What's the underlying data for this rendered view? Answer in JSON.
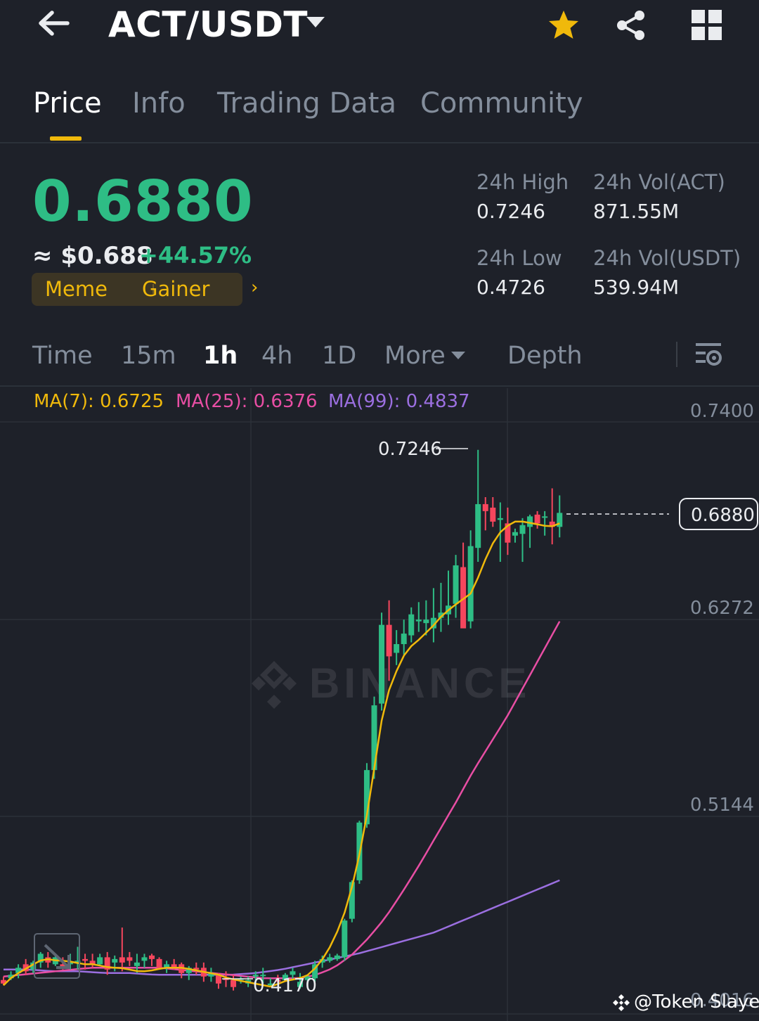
{
  "header": {
    "pair": "ACT/USDT",
    "icons": [
      "back-arrow-icon",
      "chevron-down-icon",
      "star-icon",
      "share-icon",
      "grid-icon"
    ],
    "star_color": "#f0b90b"
  },
  "tabs": [
    {
      "label": "Price",
      "active": true
    },
    {
      "label": "Info",
      "active": false
    },
    {
      "label": "Trading Data",
      "active": false
    },
    {
      "label": "Community",
      "active": false
    }
  ],
  "ticker": {
    "price": "0.6880",
    "fiat_price": "≈ $0.688",
    "change": "+44.57%",
    "tags": [
      "Meme",
      "Gainer"
    ],
    "stats": {
      "high_label": "24h High",
      "high": "0.7246",
      "low_label": "24h Low",
      "low": "0.4726",
      "vol_base_label": "24h Vol(ACT)",
      "vol_base": "871.55M",
      "vol_quote_label": "24h Vol(USDT)",
      "vol_quote": "539.94M"
    }
  },
  "intervals": {
    "items": [
      {
        "label": "Time",
        "active": false
      },
      {
        "label": "15m",
        "active": false
      },
      {
        "label": "1h",
        "active": true
      },
      {
        "label": "4h",
        "active": false
      },
      {
        "label": "1D",
        "active": false
      },
      {
        "label": "More",
        "active": false
      },
      {
        "label": "Depth",
        "active": false
      }
    ]
  },
  "chart_data": {
    "type": "candlestick",
    "watermark": "BINANCE",
    "ma_legend": [
      {
        "label": "MA(7): 0.6725",
        "color": "#f0b90b"
      },
      {
        "label": "MA(25): 0.6376",
        "color": "#e84ea4"
      },
      {
        "label": "MA(99): 0.4837",
        "color": "#9b6fe0"
      }
    ],
    "y_axis_labels": [
      "0.7400",
      "0.6272",
      "0.5144",
      "0.4016"
    ],
    "ylim": [
      0.4016,
      0.74
    ],
    "last_price_label": "0.6880",
    "high_annotation": "0.7246",
    "low_annotation": "0.4170",
    "colors": {
      "up": "#2ebd85",
      "down": "#f6465d",
      "ma7": "#f0b90b",
      "ma25": "#e84ea4",
      "ma99": "#9b6fe0"
    },
    "candles": [
      [
        0.421,
        0.423,
        0.418,
        0.419
      ],
      [
        0.422,
        0.426,
        0.421,
        0.424
      ],
      [
        0.425,
        0.43,
        0.422,
        0.428
      ],
      [
        0.43,
        0.433,
        0.424,
        0.426
      ],
      [
        0.427,
        0.432,
        0.425,
        0.431
      ],
      [
        0.431,
        0.437,
        0.428,
        0.436
      ],
      [
        0.434,
        0.437,
        0.428,
        0.431
      ],
      [
        0.43,
        0.436,
        0.429,
        0.434
      ],
      [
        0.43,
        0.434,
        0.427,
        0.428
      ],
      [
        0.43,
        0.436,
        0.427,
        0.431
      ],
      [
        0.431,
        0.44,
        0.427,
        0.432
      ],
      [
        0.433,
        0.436,
        0.427,
        0.432
      ],
      [
        0.432,
        0.436,
        0.428,
        0.43
      ],
      [
        0.43,
        0.436,
        0.429,
        0.434
      ],
      [
        0.434,
        0.437,
        0.424,
        0.427
      ],
      [
        0.431,
        0.435,
        0.426,
        0.433
      ],
      [
        0.434,
        0.451,
        0.426,
        0.431
      ],
      [
        0.434,
        0.437,
        0.429,
        0.432
      ],
      [
        0.429,
        0.436,
        0.425,
        0.431
      ],
      [
        0.432,
        0.436,
        0.428,
        0.434
      ],
      [
        0.435,
        0.436,
        0.429,
        0.433
      ],
      [
        0.433,
        0.434,
        0.427,
        0.428
      ],
      [
        0.428,
        0.432,
        0.425,
        0.43
      ],
      [
        0.43,
        0.433,
        0.427,
        0.428
      ],
      [
        0.43,
        0.431,
        0.422,
        0.425
      ],
      [
        0.425,
        0.429,
        0.421,
        0.428
      ],
      [
        0.428,
        0.431,
        0.424,
        0.427
      ],
      [
        0.428,
        0.431,
        0.42,
        0.423
      ],
      [
        0.423,
        0.428,
        0.42,
        0.425
      ],
      [
        0.424,
        0.425,
        0.416,
        0.419
      ],
      [
        0.422,
        0.426,
        0.417,
        0.421
      ],
      [
        0.421,
        0.424,
        0.415,
        0.417
      ],
      [
        0.421,
        0.423,
        0.419,
        0.422
      ],
      [
        0.419,
        0.423,
        0.417,
        0.421
      ],
      [
        0.423,
        0.426,
        0.419,
        0.424
      ],
      [
        0.424,
        0.428,
        0.419,
        0.424
      ],
      [
        0.418,
        0.422,
        0.417,
        0.419
      ],
      [
        0.421,
        0.424,
        0.419,
        0.42
      ],
      [
        0.421,
        0.425,
        0.42,
        0.424
      ],
      [
        0.424,
        0.428,
        0.421,
        0.426
      ],
      [
        0.417,
        0.425,
        0.416,
        0.42
      ],
      [
        0.421,
        0.424,
        0.419,
        0.423
      ],
      [
        0.422,
        0.432,
        0.42,
        0.43
      ],
      [
        0.431,
        0.435,
        0.428,
        0.433
      ],
      [
        0.432,
        0.436,
        0.431,
        0.434
      ],
      [
        0.433,
        0.436,
        0.432,
        0.435
      ],
      [
        0.434,
        0.456,
        0.432,
        0.455
      ],
      [
        0.456,
        0.478,
        0.454,
        0.477
      ],
      [
        0.478,
        0.512,
        0.476,
        0.511
      ],
      [
        0.51,
        0.545,
        0.508,
        0.541
      ],
      [
        0.541,
        0.583,
        0.536,
        0.578
      ],
      [
        0.579,
        0.631,
        0.575,
        0.624
      ],
      [
        0.624,
        0.638,
        0.592,
        0.606
      ],
      [
        0.608,
        0.621,
        0.601,
        0.613
      ],
      [
        0.613,
        0.627,
        0.607,
        0.619
      ],
      [
        0.618,
        0.634,
        0.614,
        0.63
      ],
      [
        0.626,
        0.637,
        0.62,
        0.627
      ],
      [
        0.625,
        0.638,
        0.618,
        0.627
      ],
      [
        0.622,
        0.645,
        0.614,
        0.628
      ],
      [
        0.628,
        0.648,
        0.62,
        0.631
      ],
      [
        0.63,
        0.655,
        0.624,
        0.635
      ],
      [
        0.636,
        0.664,
        0.628,
        0.658
      ],
      [
        0.657,
        0.671,
        0.624,
        0.622
      ],
      [
        0.626,
        0.678,
        0.622,
        0.669
      ],
      [
        0.668,
        0.724,
        0.66,
        0.693
      ],
      [
        0.693,
        0.697,
        0.678,
        0.689
      ],
      [
        0.691,
        0.697,
        0.68,
        0.683
      ],
      [
        0.684,
        0.694,
        0.66,
        0.685
      ],
      [
        0.682,
        0.691,
        0.664,
        0.671
      ],
      [
        0.675,
        0.679,
        0.671,
        0.677
      ],
      [
        0.676,
        0.685,
        0.66,
        0.681
      ],
      [
        0.68,
        0.687,
        0.668,
        0.686
      ],
      [
        0.687,
        0.689,
        0.679,
        0.682
      ],
      [
        0.686,
        0.689,
        0.675,
        0.686
      ],
      [
        0.683,
        0.702,
        0.67,
        0.68
      ],
      [
        0.68,
        0.698,
        0.674,
        0.688
      ]
    ],
    "ma7": [
      0.418,
      0.423,
      0.426,
      0.429,
      0.432,
      0.433,
      0.432,
      0.432,
      0.431,
      0.43,
      0.43,
      0.429,
      0.428,
      0.428,
      0.427,
      0.426,
      0.426,
      0.427,
      0.428,
      0.428,
      0.428,
      0.427,
      0.426,
      0.425,
      0.424,
      0.422,
      0.421,
      0.42,
      0.419,
      0.418,
      0.417,
      0.42,
      0.421,
      0.422,
      0.424,
      0.429,
      0.436,
      0.446,
      0.459,
      0.477,
      0.5,
      0.53,
      0.566,
      0.587,
      0.6,
      0.61,
      0.614,
      0.619,
      0.624,
      0.63,
      0.634,
      0.638,
      0.641,
      0.652,
      0.665,
      0.675,
      0.68,
      0.683,
      0.683,
      0.682,
      0.681,
      0.68,
      0.682
    ],
    "ma25": [
      0.423,
      0.424,
      0.425,
      0.426,
      0.427,
      0.428,
      0.428,
      0.428,
      0.428,
      0.428,
      0.427,
      0.426,
      0.425,
      0.424,
      0.423,
      0.422,
      0.422,
      0.422,
      0.424,
      0.428,
      0.435,
      0.445,
      0.457,
      0.472,
      0.488,
      0.505,
      0.522,
      0.54,
      0.556,
      0.572,
      0.59,
      0.608,
      0.626
    ],
    "ma99": [
      0.427,
      0.427,
      0.426,
      0.426,
      0.425,
      0.425,
      0.424,
      0.424,
      0.424,
      0.424,
      0.425,
      0.427,
      0.43,
      0.433,
      0.436,
      0.44,
      0.444,
      0.448,
      0.454,
      0.46,
      0.466,
      0.472,
      0.478
    ]
  },
  "watermark_credit": "@Token Slayer"
}
